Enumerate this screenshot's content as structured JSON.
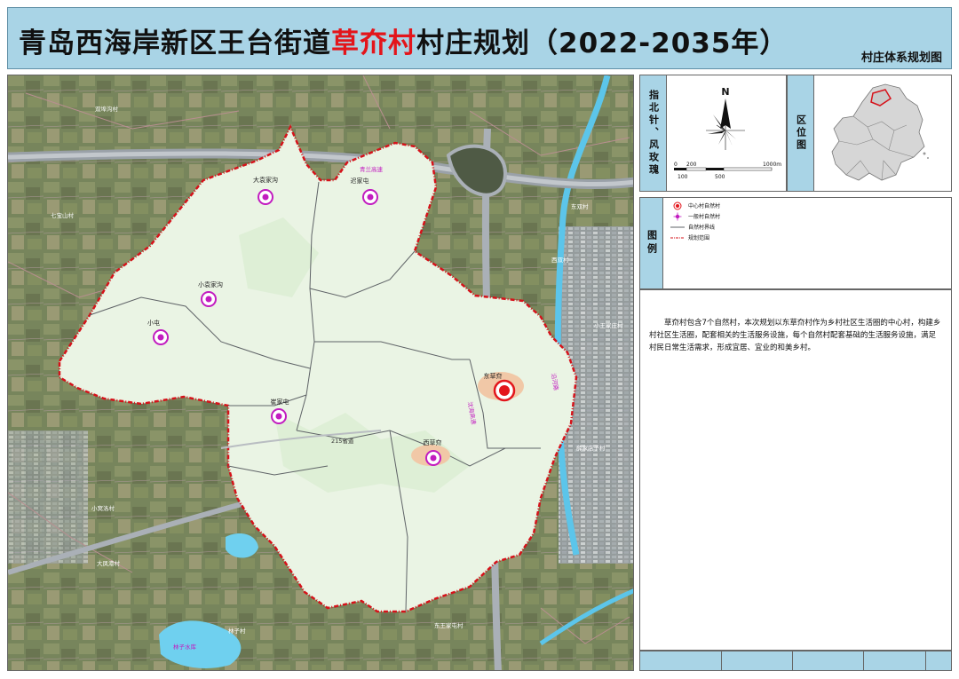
{
  "title": {
    "prefix": "青岛西海岸新区王台街道",
    "highlight": "草夼村",
    "suffix": "村庄规划（2022-2035年）",
    "subtitle": "村庄体系规划图"
  },
  "compass": {
    "label": "指北针、风玫瑰",
    "north": "N",
    "scale_top": [
      "0",
      "200",
      "1000m"
    ],
    "scale_bottom": [
      "100",
      "500"
    ]
  },
  "location_map": {
    "label": "区位图"
  },
  "legend": {
    "label": "图例",
    "items": [
      {
        "symbol": "central-village",
        "text": "中心村自然村"
      },
      {
        "symbol": "general-village",
        "text": "一般村自然村"
      },
      {
        "symbol": "village-boundary",
        "text": "自然村界线"
      },
      {
        "symbol": "planning-boundary",
        "text": "规划范围"
      }
    ]
  },
  "description": "草夼村包含7个自然村，本次规划以东草夼村作为乡村社区生活圈的中心村，构建乡村社区生活圈，配套相关的生活服务设施，每个自然村配套基础的生活服务设施，满足村民日常生活需求，形成宜居、宜业的和美乡村。",
  "map": {
    "villages_inside": [
      {
        "name": "大袁家沟",
        "type": "general"
      },
      {
        "name": "迟家屯",
        "type": "general"
      },
      {
        "name": "小袁家沟",
        "type": "general"
      },
      {
        "name": "小屯",
        "type": "general"
      },
      {
        "name": "崔家屯",
        "type": "general"
      },
      {
        "name": "东草夼",
        "type": "central"
      },
      {
        "name": "西草夼",
        "type": "general"
      }
    ],
    "villages_outside": [
      "双埠沟村",
      "七宝山村",
      "东双村",
      "西双村",
      "小王家庄村",
      "薛家店子村",
      "小窝洛村",
      "大凤港村",
      "林子村",
      "东王家屯村"
    ],
    "roads": [
      "青兰高速",
      "215省道",
      "沈海高速",
      "沿河路"
    ],
    "water": [
      "林子水库"
    ],
    "colors": {
      "boundary": "#d6121a",
      "central_marker": "#e3151b",
      "general_marker": "#c21cc0",
      "village_area": "#eef6e8",
      "header_bg": "#a9d4e6"
    }
  }
}
